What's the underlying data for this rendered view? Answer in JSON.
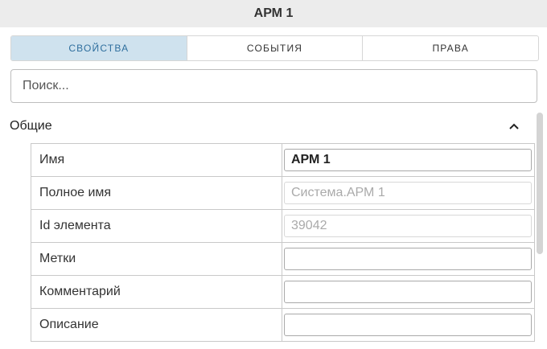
{
  "window": {
    "title": "АРМ 1"
  },
  "tabs": [
    {
      "label": "СВОЙСТВА",
      "active": true
    },
    {
      "label": "СОБЫТИЯ",
      "active": false
    },
    {
      "label": "ПРАВА",
      "active": false
    }
  ],
  "search": {
    "placeholder": "Поиск...",
    "value": ""
  },
  "section": {
    "title": "Общие",
    "icon": "chevron-up-icon",
    "expanded": true
  },
  "properties": [
    {
      "label": "Имя",
      "value": "АРМ 1",
      "readonly": false
    },
    {
      "label": "Полное имя",
      "value": "Система.АРМ 1",
      "readonly": true
    },
    {
      "label": "Id элемента",
      "value": "39042",
      "readonly": true
    },
    {
      "label": "Метки",
      "value": "",
      "readonly": false
    },
    {
      "label": "Комментарий",
      "value": "",
      "readonly": false
    },
    {
      "label": "Описание",
      "value": "",
      "readonly": false
    }
  ],
  "colors": {
    "titlebar_bg": "#ececec",
    "active_tab_bg": "#cfe2ee",
    "active_tab_text": "#2f6f9e",
    "readonly_text": "#aaaaaa"
  }
}
